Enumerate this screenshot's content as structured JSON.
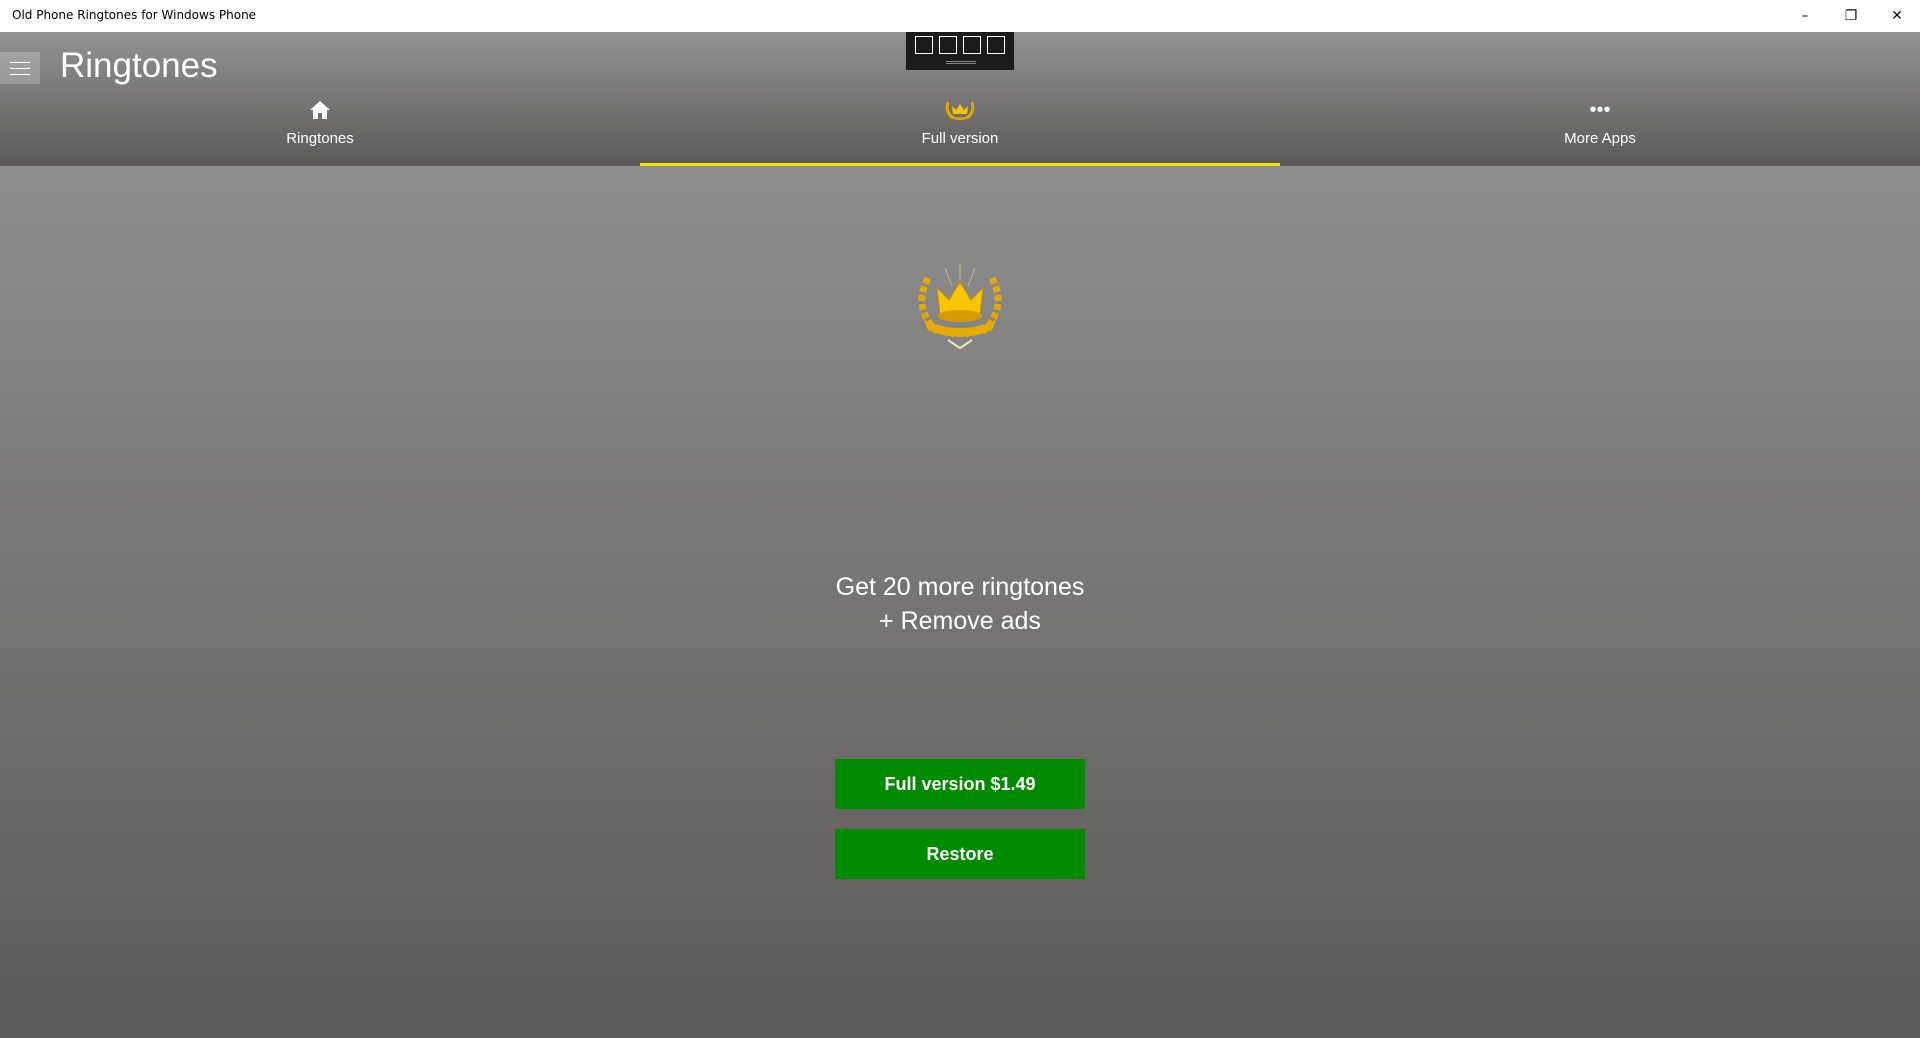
{
  "window": {
    "title": "Old Phone Ringtones for Windows Phone",
    "minimize": "–",
    "restore": "❐",
    "close": "✕"
  },
  "header": {
    "title": "Ringtones",
    "menu_icon": "hamburger-icon"
  },
  "tabs": [
    {
      "label": "Ringtones",
      "icon": "home-icon",
      "selected": false
    },
    {
      "label": "Full version",
      "icon": "crown-icon",
      "selected": true
    },
    {
      "label": "More Apps",
      "icon": "more-icon",
      "selected": false
    }
  ],
  "accent": "#f2e600",
  "main": {
    "line1": "Get 20 more ringtones",
    "line2": "+ Remove ads",
    "buy_label": "Full version $1.49",
    "restore_label": "Restore",
    "button_color": "#008a00"
  }
}
